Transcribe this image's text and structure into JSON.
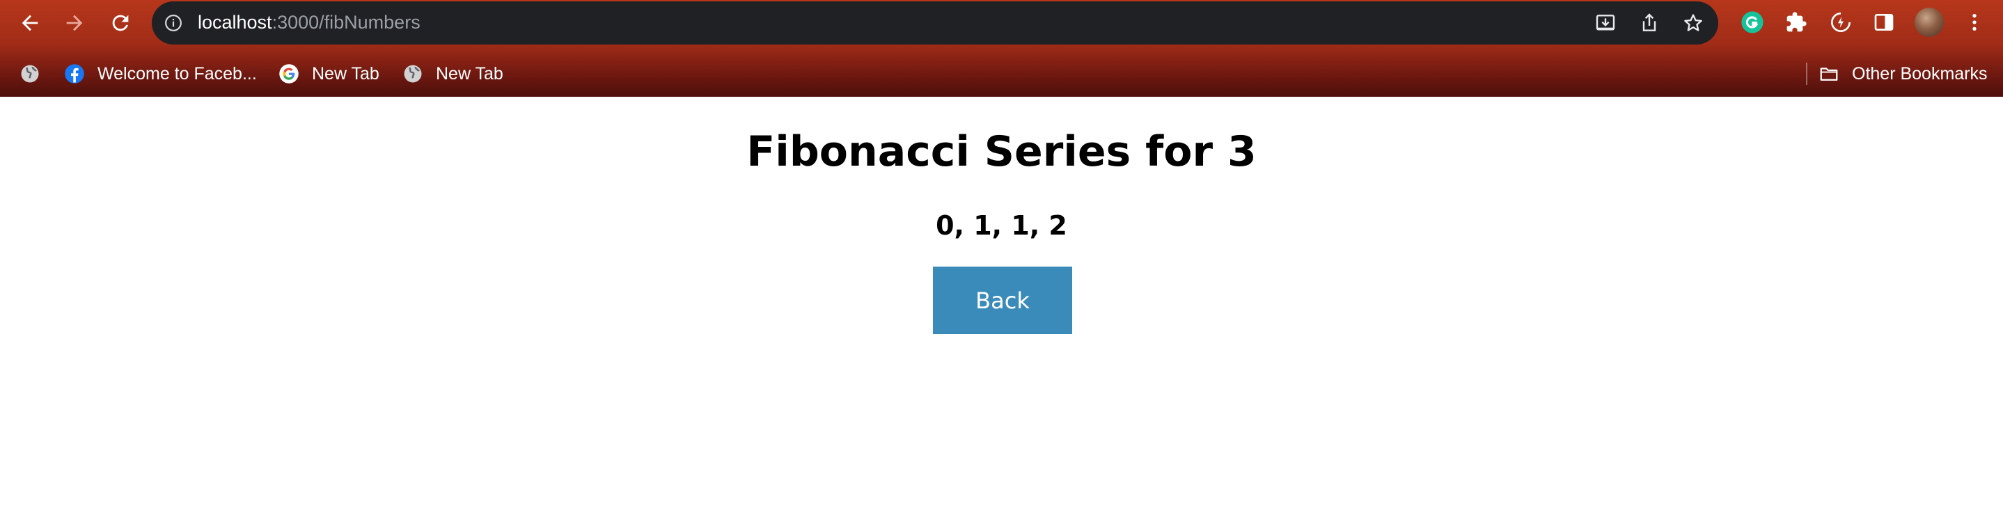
{
  "browser": {
    "url_host": "localhost",
    "url_path": ":3000/fibNumbers",
    "bookmarks": [
      {
        "label": "Welcome to Faceb...",
        "icon": "facebook-icon"
      },
      {
        "label": "New Tab",
        "icon": "google-icon"
      },
      {
        "label": "New Tab",
        "icon": "globe-icon"
      }
    ],
    "other_bookmarks_label": "Other Bookmarks"
  },
  "page": {
    "title": "Fibonacci Series for 3",
    "series": "0, 1, 1, 2",
    "back_label": "Back"
  },
  "colors": {
    "chrome_top": "#b7371b",
    "chrome_bottom": "#4d0f0b",
    "omnibox": "#202124",
    "button": "#3b8bba"
  }
}
